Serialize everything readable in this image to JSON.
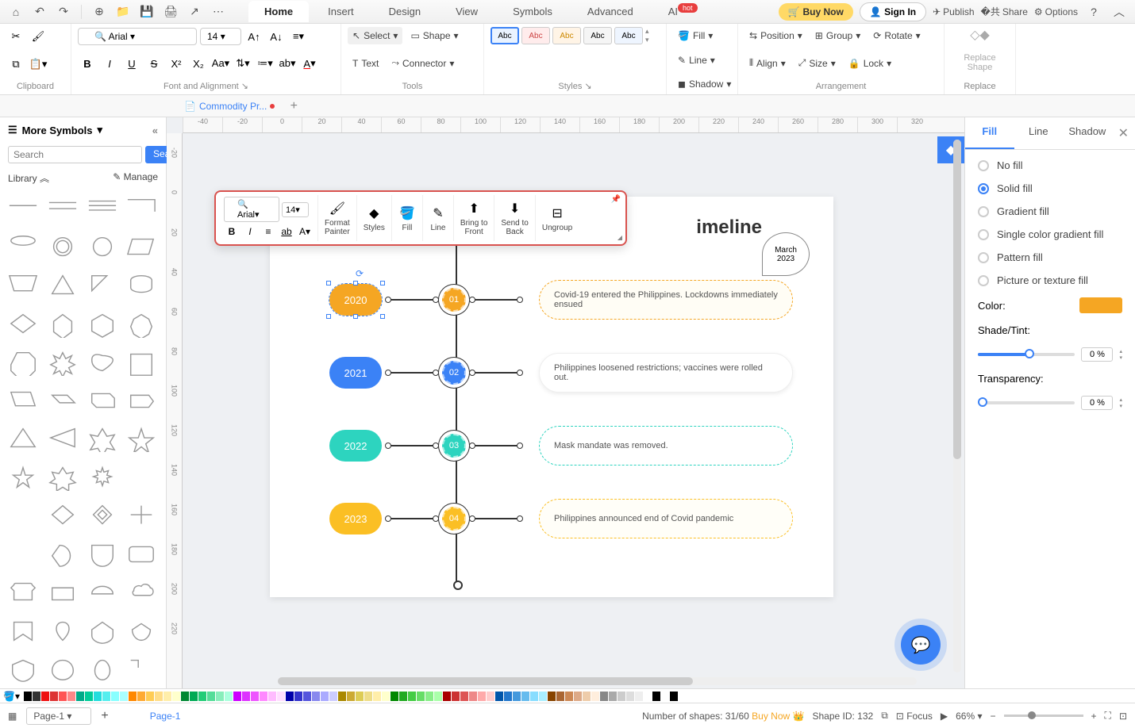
{
  "top": {
    "tabs": [
      "Home",
      "Insert",
      "Design",
      "View",
      "Symbols",
      "Advanced",
      "AI"
    ],
    "active_tab": "Home",
    "ai_badge": "hot",
    "buy_now": "Buy Now",
    "sign_in": "Sign In",
    "publish": "Publish",
    "share": "Share",
    "options": "Options"
  },
  "ribbon": {
    "clipboard_label": "Clipboard",
    "font_name": "Arial",
    "font_size": "14",
    "font_align_label": "Font and Alignment",
    "select": "Select",
    "shape": "Shape",
    "text": "Text",
    "connector": "Connector",
    "tools_label": "Tools",
    "style_label": "Styles",
    "style_text": "Abc",
    "fill": "Fill",
    "line": "Line",
    "shadow": "Shadow",
    "position": "Position",
    "align": "Align",
    "group": "Group",
    "size": "Size",
    "rotate": "Rotate",
    "lock": "Lock",
    "arrangement_label": "Arrangement",
    "replace_shape": "Replace\nShape",
    "replace_label": "Replace"
  },
  "doc": {
    "name": "Commodity Pr...",
    "unsaved": true
  },
  "left": {
    "title": "More Symbols",
    "search_placeholder": "Search",
    "search_btn": "Search",
    "library": "Library",
    "manage": "Manage"
  },
  "ruler_h": [
    "-40",
    "-20",
    "0",
    "20",
    "40",
    "60",
    "80",
    "100",
    "120",
    "140",
    "160",
    "180",
    "200",
    "220",
    "240",
    "260",
    "280",
    "300",
    "320"
  ],
  "ruler_v": [
    "-20",
    "0",
    "20",
    "40",
    "60",
    "80",
    "100",
    "120",
    "140",
    "160",
    "180",
    "200",
    "220"
  ],
  "canvas": {
    "title_suffix": "imeline",
    "date": "March 2023",
    "rows": [
      {
        "year": "2020",
        "step": "01",
        "color": "#f5a623",
        "desc": "Covid-19 entered the Philippines. Lockdowns immediately ensued",
        "border": "1px dashed #f5a623",
        "bg": "#fffdf5",
        "selected": true
      },
      {
        "year": "2021",
        "step": "02",
        "color": "#3b82f6",
        "desc": "Philippines loosened restrictions; vaccines were rolled out.",
        "border": "1px solid #eee",
        "bg": "#fff",
        "shadow": true
      },
      {
        "year": "2022",
        "step": "03",
        "color": "#2dd4bf",
        "desc": "Mask mandate was removed.",
        "border": "1px dashed #2dd4bf",
        "bg": "#fff"
      },
      {
        "year": "2023",
        "step": "04",
        "color": "#fbbf24",
        "desc": "Philippines announced end of Covid pandemic",
        "border": "1px dashed #fbbf24",
        "bg": "#fffef8"
      }
    ]
  },
  "ctx": {
    "font": "Arial",
    "size": "14",
    "format_painter": "Format\nPainter",
    "styles": "Styles",
    "fill": "Fill",
    "line": "Line",
    "bring_front": "Bring to\nFront",
    "send_back": "Send to\nBack",
    "ungroup": "Ungroup"
  },
  "right": {
    "tabs": [
      "Fill",
      "Line",
      "Shadow"
    ],
    "active": "Fill",
    "no_fill": "No fill",
    "solid_fill": "Solid fill",
    "gradient_fill": "Gradient fill",
    "single_gradient": "Single color gradient fill",
    "pattern_fill": "Pattern fill",
    "picture_fill": "Picture or texture fill",
    "color_label": "Color:",
    "color_value": "#f5a623",
    "shade_label": "Shade/Tint:",
    "shade_value": "0 %",
    "transparency_label": "Transparency:",
    "transparency_value": "0 %"
  },
  "status": {
    "page_select": "Page-1",
    "page_tab": "Page-1",
    "shapes_count": "Number of shapes: 31/60",
    "buy_now": "Buy Now",
    "shape_id": "Shape ID: 132",
    "focus": "Focus",
    "zoom": "66%"
  },
  "colors": [
    "#000",
    "#333",
    "#e11",
    "#d33",
    "#f55",
    "#f88",
    "#0a8",
    "#0c9",
    "#2dd",
    "#5ee",
    "#8ff",
    "#aff",
    "#f80",
    "#fa3",
    "#fc5",
    "#fd8",
    "#fea",
    "#ffc",
    "#083",
    "#0a5",
    "#2c7",
    "#5d9",
    "#8eb",
    "#afd",
    "#c0f",
    "#d3f",
    "#e5f",
    "#f8f",
    "#fbf",
    "#fdf",
    "#00a",
    "#33c",
    "#55d",
    "#88e",
    "#aaf",
    "#ccf",
    "#a80",
    "#ca3",
    "#dc5",
    "#ed8",
    "#fea",
    "#ffc",
    "#080",
    "#2a2",
    "#4c4",
    "#6d6",
    "#8e8",
    "#afa",
    "#a00",
    "#c33",
    "#d55",
    "#e88",
    "#faa",
    "#fcc",
    "#05a",
    "#27c",
    "#49d",
    "#6be",
    "#8df",
    "#aef",
    "#840",
    "#a63",
    "#c85",
    "#da8",
    "#eca",
    "#fed",
    "#888",
    "#aaa",
    "#ccc",
    "#ddd",
    "#eee",
    "#fff",
    "#000",
    "#fff",
    "#000"
  ]
}
